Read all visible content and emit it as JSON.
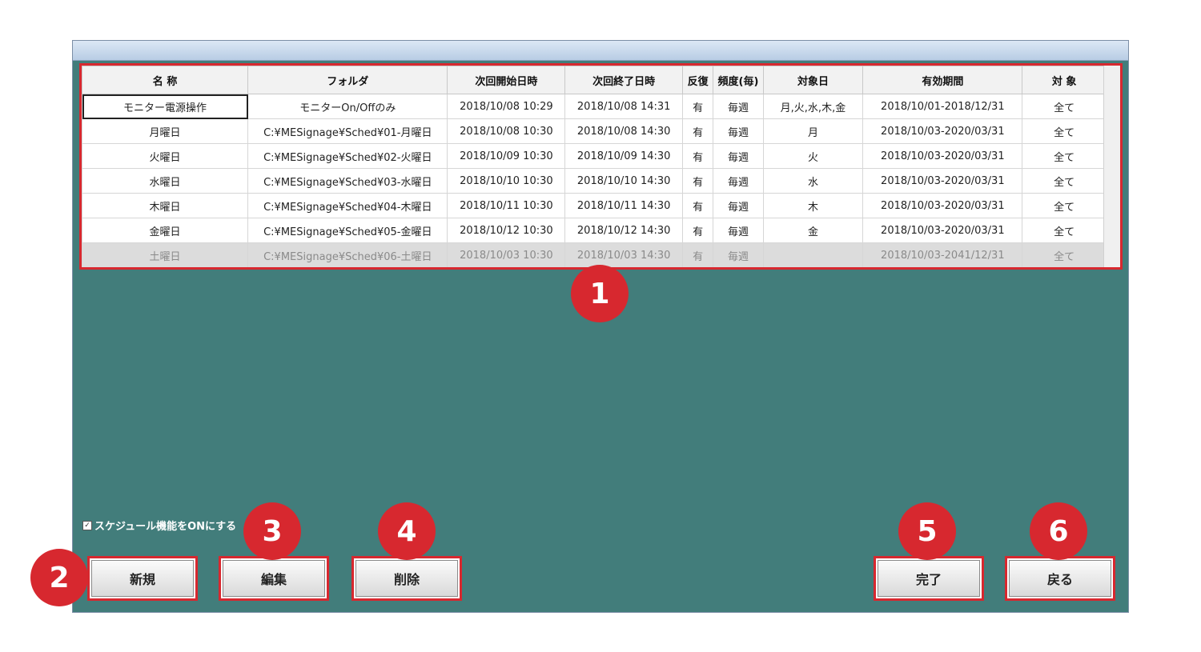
{
  "checkbox_label": "スケジュール機能をONにする",
  "checkbox_checked": true,
  "table": {
    "headers": [
      "名 称",
      "フォルダ",
      "次回開始日時",
      "次回終了日時",
      "反復",
      "頻度(毎)",
      "対象日",
      "有効期間",
      "対 象"
    ],
    "rows": [
      [
        "モニター電源操作",
        "モニターOn/Offのみ",
        "2018/10/08 10:29",
        "2018/10/08 14:31",
        "有",
        "毎週",
        "月,火,水,木,金",
        "2018/10/01-2018/12/31",
        "全て"
      ],
      [
        "月曜日",
        "C:¥MESignage¥Sched¥01-月曜日",
        "2018/10/08 10:30",
        "2018/10/08 14:30",
        "有",
        "毎週",
        "月",
        "2018/10/03-2020/03/31",
        "全て"
      ],
      [
        "火曜日",
        "C:¥MESignage¥Sched¥02-火曜日",
        "2018/10/09 10:30",
        "2018/10/09 14:30",
        "有",
        "毎週",
        "火",
        "2018/10/03-2020/03/31",
        "全て"
      ],
      [
        "水曜日",
        "C:¥MESignage¥Sched¥03-水曜日",
        "2018/10/10 10:30",
        "2018/10/10 14:30",
        "有",
        "毎週",
        "水",
        "2018/10/03-2020/03/31",
        "全て"
      ],
      [
        "木曜日",
        "C:¥MESignage¥Sched¥04-木曜日",
        "2018/10/11 10:30",
        "2018/10/11 14:30",
        "有",
        "毎週",
        "木",
        "2018/10/03-2020/03/31",
        "全て"
      ],
      [
        "金曜日",
        "C:¥MESignage¥Sched¥05-金曜日",
        "2018/10/12 10:30",
        "2018/10/12 14:30",
        "有",
        "毎週",
        "金",
        "2018/10/03-2020/03/31",
        "全て"
      ],
      [
        "土曜日",
        "C:¥MESignage¥Sched¥06-土曜日",
        "2018/10/03 10:30",
        "2018/10/03 14:30",
        "有",
        "毎週",
        "",
        "2018/10/03-2041/12/31",
        "全て"
      ]
    ]
  },
  "buttons": {
    "new": "新規",
    "edit": "編集",
    "delete": "削除",
    "done": "完了",
    "back": "戻る"
  },
  "badges": [
    "1",
    "2",
    "3",
    "4",
    "5",
    "6"
  ],
  "colors": {
    "window_bg": "#427d7b",
    "highlight_red": "#d7282f",
    "disabled_row": "#dcdcdc"
  }
}
